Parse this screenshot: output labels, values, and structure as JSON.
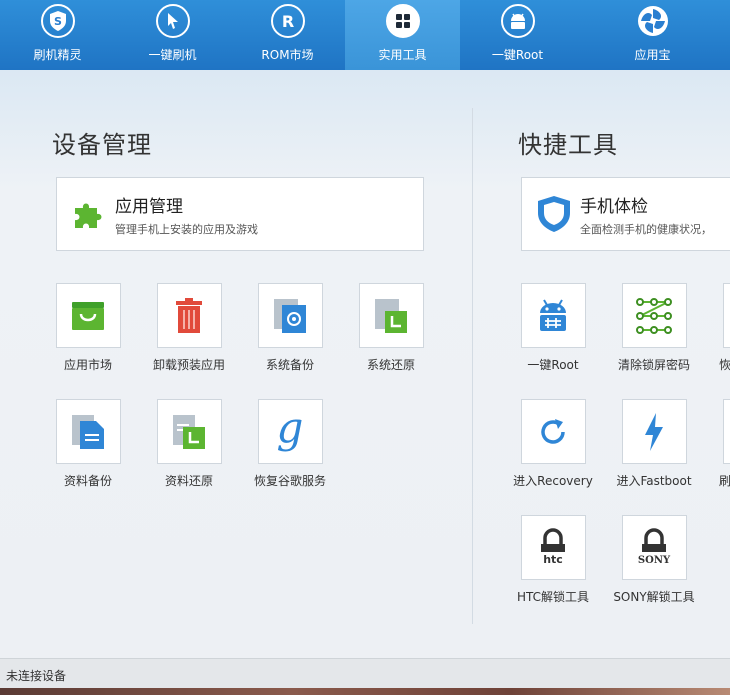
{
  "nav": {
    "tabs": [
      {
        "label": "刷机精灵",
        "icon": "shield-s-icon"
      },
      {
        "label": "一键刷机",
        "icon": "cursor-icon"
      },
      {
        "label": "ROM市场",
        "icon": "r-letter-icon"
      },
      {
        "label": "实用工具",
        "icon": "grid-icon"
      },
      {
        "label": "一键Root",
        "icon": "android-icon"
      },
      {
        "label": "应用宝",
        "icon": "app-treasure-icon"
      }
    ],
    "active_tab": "实用工具"
  },
  "device_mgmt": {
    "title": "设备管理",
    "card": {
      "title": "应用管理",
      "desc": "管理手机上安装的应用及游戏",
      "icon": "puzzle-icon"
    },
    "tools": [
      {
        "label": "应用市场",
        "icon": "shopping-bag-icon"
      },
      {
        "label": "卸载预装应用",
        "icon": "trash-icon"
      },
      {
        "label": "系统备份",
        "icon": "system-backup-icon"
      },
      {
        "label": "系统还原",
        "icon": "system-restore-icon"
      },
      {
        "label": "资料备份",
        "icon": "document-backup-icon"
      },
      {
        "label": "资料还原",
        "icon": "document-restore-icon"
      },
      {
        "label": "恢复谷歌服务",
        "icon": "google-g-icon"
      }
    ]
  },
  "quick_tools": {
    "title": "快捷工具",
    "card": {
      "title": "手机体检",
      "desc": "全面检测手机的健康状况，",
      "icon": "shield-check-icon"
    },
    "tools": [
      {
        "label": "一键Root",
        "icon": "android-root-icon"
      },
      {
        "label": "清除锁屏密码",
        "icon": "pattern-lock-icon"
      },
      {
        "label": "恢",
        "icon": "partial-icon"
      },
      {
        "label": "进入Recovery",
        "icon": "refresh-icon"
      },
      {
        "label": "进入Fastboot",
        "icon": "lightning-icon"
      },
      {
        "label": "刷",
        "icon": "partial-icon"
      },
      {
        "label": "HTC解锁工具",
        "icon": "htc-lock-icon",
        "brand": "htc"
      },
      {
        "label": "SONY解锁工具",
        "icon": "sony-lock-icon",
        "brand": "SONY"
      }
    ]
  },
  "status": {
    "text": "未连接设备"
  },
  "colors": {
    "nav_bg": "#1f74c4",
    "accent_green": "#5cb531",
    "accent_red": "#e14a3b",
    "accent_blue": "#2f86d6"
  }
}
